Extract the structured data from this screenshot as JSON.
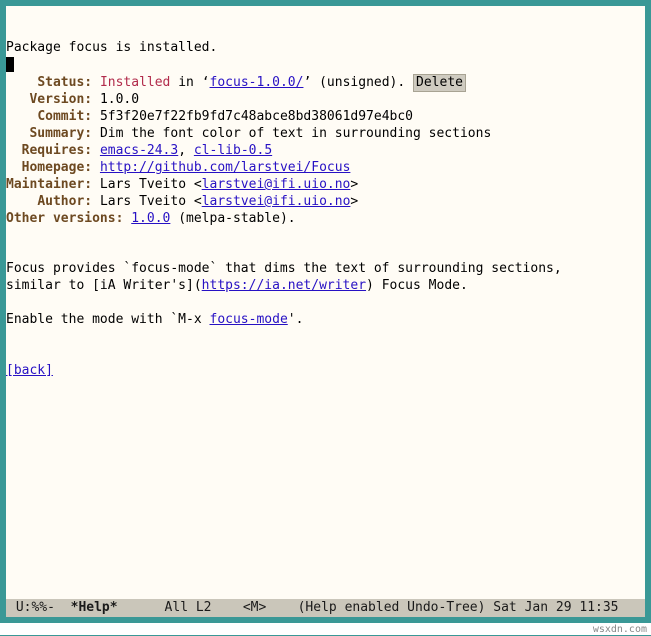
{
  "header": {
    "line": "Package focus is installed."
  },
  "fields": {
    "status": {
      "label": "Status:",
      "value": "Installed",
      "in": "in",
      "dir": "focus-1.0.0/",
      "signed": "(unsigned).",
      "delete": "Delete"
    },
    "version": {
      "label": "Version:",
      "value": "1.0.0"
    },
    "commit": {
      "label": "Commit:",
      "value": "5f3f20e7f22fb9fd7c48abce8bd38061d97e4bc0"
    },
    "summary": {
      "label": "Summary:",
      "value": "Dim the font color of text in surrounding sections"
    },
    "requires": {
      "label": "Requires:",
      "items": [
        "emacs-24.3",
        "cl-lib-0.5"
      ]
    },
    "homepage": {
      "label": "Homepage:",
      "value": "http://github.com/larstvei/Focus"
    },
    "maintainer": {
      "label": "Maintainer:",
      "name": "Lars Tveito",
      "email": "larstvei@ifi.uio.no"
    },
    "author": {
      "label": "Author:",
      "name": "Lars Tveito",
      "email": "larstvei@ifi.uio.no"
    },
    "other": {
      "label": "Other versions:",
      "version": "1.0.0",
      "repo": "(melpa-stable)."
    }
  },
  "body": {
    "line1a": "Focus provides `focus-mode` that dims the text of surrounding sections,",
    "line2a": "similar to [iA Writer's](",
    "ia_link": "https://ia.net/writer",
    "line2b": ") Focus Mode.",
    "enable_a": "Enable the mode with `M-x ",
    "enable_link": "focus-mode",
    "enable_b": "'.",
    "back": "[back]"
  },
  "modeline": {
    "left": " U:%%-  ",
    "bufname": "*Help*",
    "mid": "      All L2    <M>    (Help enabled Undo-Tree) Sat Jan 29 11:35"
  },
  "footer": "wsxdn.com"
}
